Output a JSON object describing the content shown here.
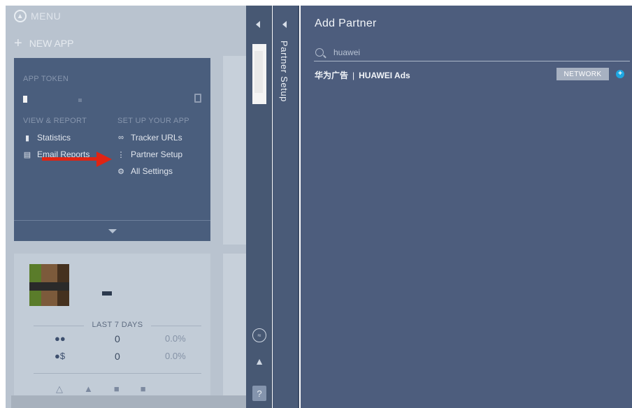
{
  "menu": {
    "label": "MENU"
  },
  "new_app": {
    "plus": "+",
    "label": "NEW APP"
  },
  "app_card": {
    "token_caption": "APP TOKEN",
    "view_report_caption": "VIEW & REPORT",
    "setup_caption": "SET UP YOUR APP",
    "links": {
      "statistics": "Statistics",
      "email_reports": "Email Reports",
      "tracker_urls": "Tracker URLs",
      "partner_setup": "Partner Setup",
      "all_settings": "All Settings"
    }
  },
  "stats": {
    "period_label": "LAST 7 DAYS",
    "rows": [
      {
        "icon": "users-icon",
        "value": "0",
        "percent": "0.0%"
      },
      {
        "icon": "paying-users-icon",
        "value": "0",
        "percent": "0.0%"
      }
    ]
  },
  "rail": {
    "partner_setup_title": "Partner Setup",
    "help_label": "?"
  },
  "panel": {
    "title": "Add Partner",
    "search": {
      "value": "huawei",
      "placeholder": ""
    },
    "results": [
      {
        "name_cn": "华为广告",
        "separator": "|",
        "name_en": "HUAWEI Ads",
        "badge": "NETWORK"
      }
    ]
  },
  "colors": {
    "panel_bg": "#4d5d7d",
    "rail_bg": "#475873",
    "accent": "#1ea7e1",
    "arrow_red": "#e02413",
    "badge_bg": "#a7b1c1"
  }
}
